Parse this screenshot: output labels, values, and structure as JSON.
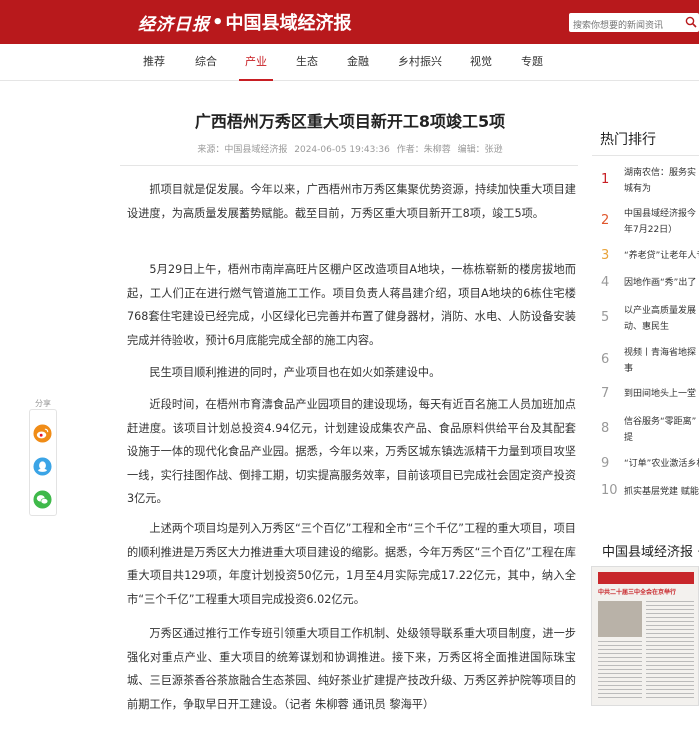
{
  "header": {
    "logo_script": "经济日报",
    "logo_dot": "•",
    "logo_main": "中国县域经济报",
    "search_placeholder": "搜索你想要的新闻资讯",
    "brand_color": "#b8191c"
  },
  "nav": {
    "items": [
      {
        "label": "推荐",
        "active": false
      },
      {
        "label": "综合",
        "active": false
      },
      {
        "label": "产业",
        "active": true
      },
      {
        "label": "生态",
        "active": false
      },
      {
        "label": "金融",
        "active": false
      },
      {
        "label": "乡村振兴",
        "active": false
      },
      {
        "label": "视觉",
        "active": false
      },
      {
        "label": "专题",
        "active": false
      }
    ]
  },
  "article": {
    "title": "广西梧州万秀区重大项目新开工8项竣工5项",
    "meta": {
      "source": "来源：中国县域经济报",
      "datetime": "2024-06-05 19:43:36",
      "author": "作者：朱柳蓉",
      "editor": "编辑：张逊"
    },
    "paragraphs": [
      "抓项目就是促发展。今年以来，广西梧州市万秀区集聚优势资源，持续加快重大项目建设进度，为高质量发展蓄势赋能。截至目前，万秀区重大项目新开工8项，竣工5项。",
      "5月29日上午，梧州市南岸高旺片区棚户区改造项目A地块，一栋栋崭新的楼房拔地而起，工人们正在进行燃气管道施工工作。项目负责人蒋昌建介绍，项目A地块的6栋住宅楼768套住宅建设已经完成，小区绿化已完善并布置了健身器材，消防、水电、人防设备安装完成并待验收，预计6月底能完成全部的施工内容。",
      "民生项目顺利推进的同时，产业项目也在如火如荼建设中。",
      "近段时间，在梧州市育濤食品产业园项目的建设现场，每天有近百名施工人员加班加点赶进度。该项目计划总投资4.94亿元，计划建设成集农产品、食品原料供给平台及其配套设施于一体的现代化食品产业园。据悉，今年以来，万秀区城东镇选派精干力量到项目攻坚一线，实行挂图作战、倒排工期，切实提高服务效率，目前该项目已完成社会固定资产投资3亿元。",
      "上述两个项目均是列入万秀区“三个百亿”工程和全市“三个千亿”工程的重大项目，项目的顺利推进是万秀区大力推进重大项目建设的缩影。据悉，今年万秀区“三个百亿”工程在库重大项目共129项，年度计划投资50亿元，1月至4月实际完成17.22亿元，其中，纳入全市“三个千亿”工程重大项目完成投资6.02亿元。",
      "万秀区通过推行工作专班引领重大项目工作机制、处级领导联系重大项目制度，进一步强化对重点产业、重大项目的统筹谋划和协调推进。接下来，万秀区将全面推进国际珠宝城、三巨源茶香谷茶旅融合生态茶园、纯好茶业扩建提产技改升级、万秀区养护院等项目的前期工作，争取早日开工建设。（记者 朱柳蓉 通讯员 黎海平）"
    ]
  },
  "share": {
    "label": "分享",
    "icons": [
      "weibo-icon",
      "qq-icon",
      "wechat-icon"
    ]
  },
  "sidebar": {
    "hot_title": "热门排行",
    "hot_items": [
      {
        "rank": "1",
        "lines": [
          "湖南农信：服务实",
          "城有为"
        ]
      },
      {
        "rank": "2",
        "lines": [
          "中国县域经济报今",
          "年7月22日）"
        ]
      },
      {
        "rank": "3",
        "lines": [
          "“养老贷”让老年人专"
        ]
      },
      {
        "rank": "4",
        "lines": [
          "因地作画“秀”出了"
        ]
      },
      {
        "rank": "5",
        "lines": [
          "以产业高质量发展",
          "动、惠民生"
        ]
      },
      {
        "rank": "6",
        "lines": [
          "视频丨青海省地探",
          "事"
        ]
      },
      {
        "rank": "7",
        "lines": [
          "到田间地头上一堂"
        ]
      },
      {
        "rank": "8",
        "lines": [
          "信谷服务“零距离”",
          "提"
        ]
      },
      {
        "rank": "9",
        "lines": [
          "“订单”农业激活乡村"
        ]
      },
      {
        "rank": "10",
        "lines": [
          "抓实基层党建 赋能"
        ]
      }
    ],
    "paper_title": "中国县域经济报 · 数",
    "paper_headline": "中共二十届三中全会在京举行"
  }
}
